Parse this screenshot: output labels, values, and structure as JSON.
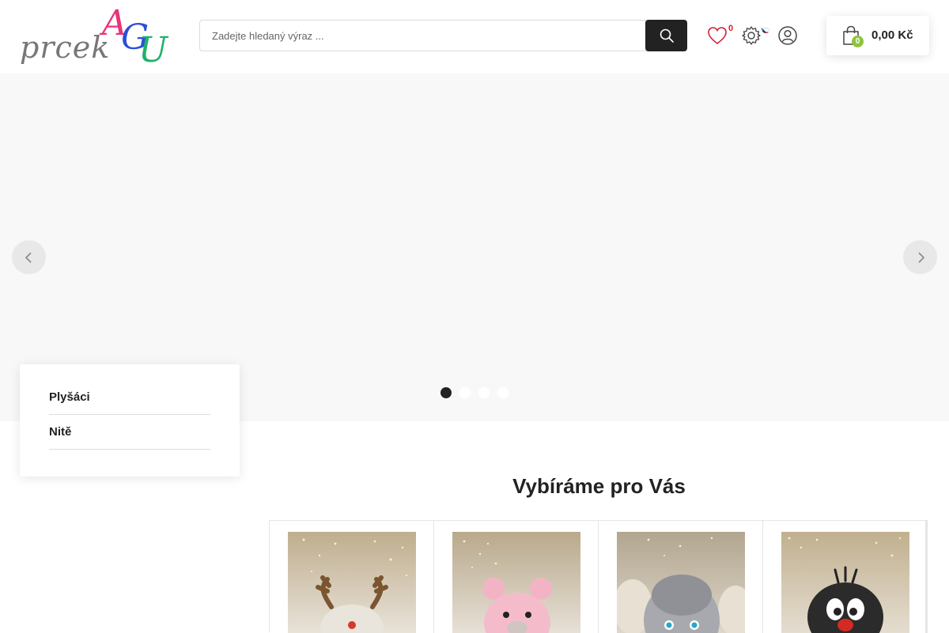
{
  "header": {
    "logo": {
      "word": "prcek",
      "letters": [
        "A",
        "G",
        "U"
      ]
    },
    "search": {
      "placeholder": "Zadejte hledaný výraz ..."
    },
    "wishlist_count": "0",
    "cart": {
      "count": "0",
      "total": "0,00 Kč"
    }
  },
  "slider": {
    "slides": 4,
    "active_slide": 1
  },
  "categories": [
    {
      "label": "Plyšáci"
    },
    {
      "label": "Nitě"
    }
  ],
  "section": {
    "title": "Vybíráme pro Vás"
  },
  "products": [
    {
      "image": "plush-reindeer"
    },
    {
      "image": "plush-pink-bear"
    },
    {
      "image": "plush-grey-bunny"
    },
    {
      "image": "plush-mole"
    }
  ],
  "colors": {
    "accent_dark": "#222222",
    "cart_badge": "#8fc43a",
    "wishlist_count": "#e02020",
    "logo_a": "#e8337a",
    "logo_g": "#2b4fd6",
    "logo_u": "#1fb26a"
  }
}
